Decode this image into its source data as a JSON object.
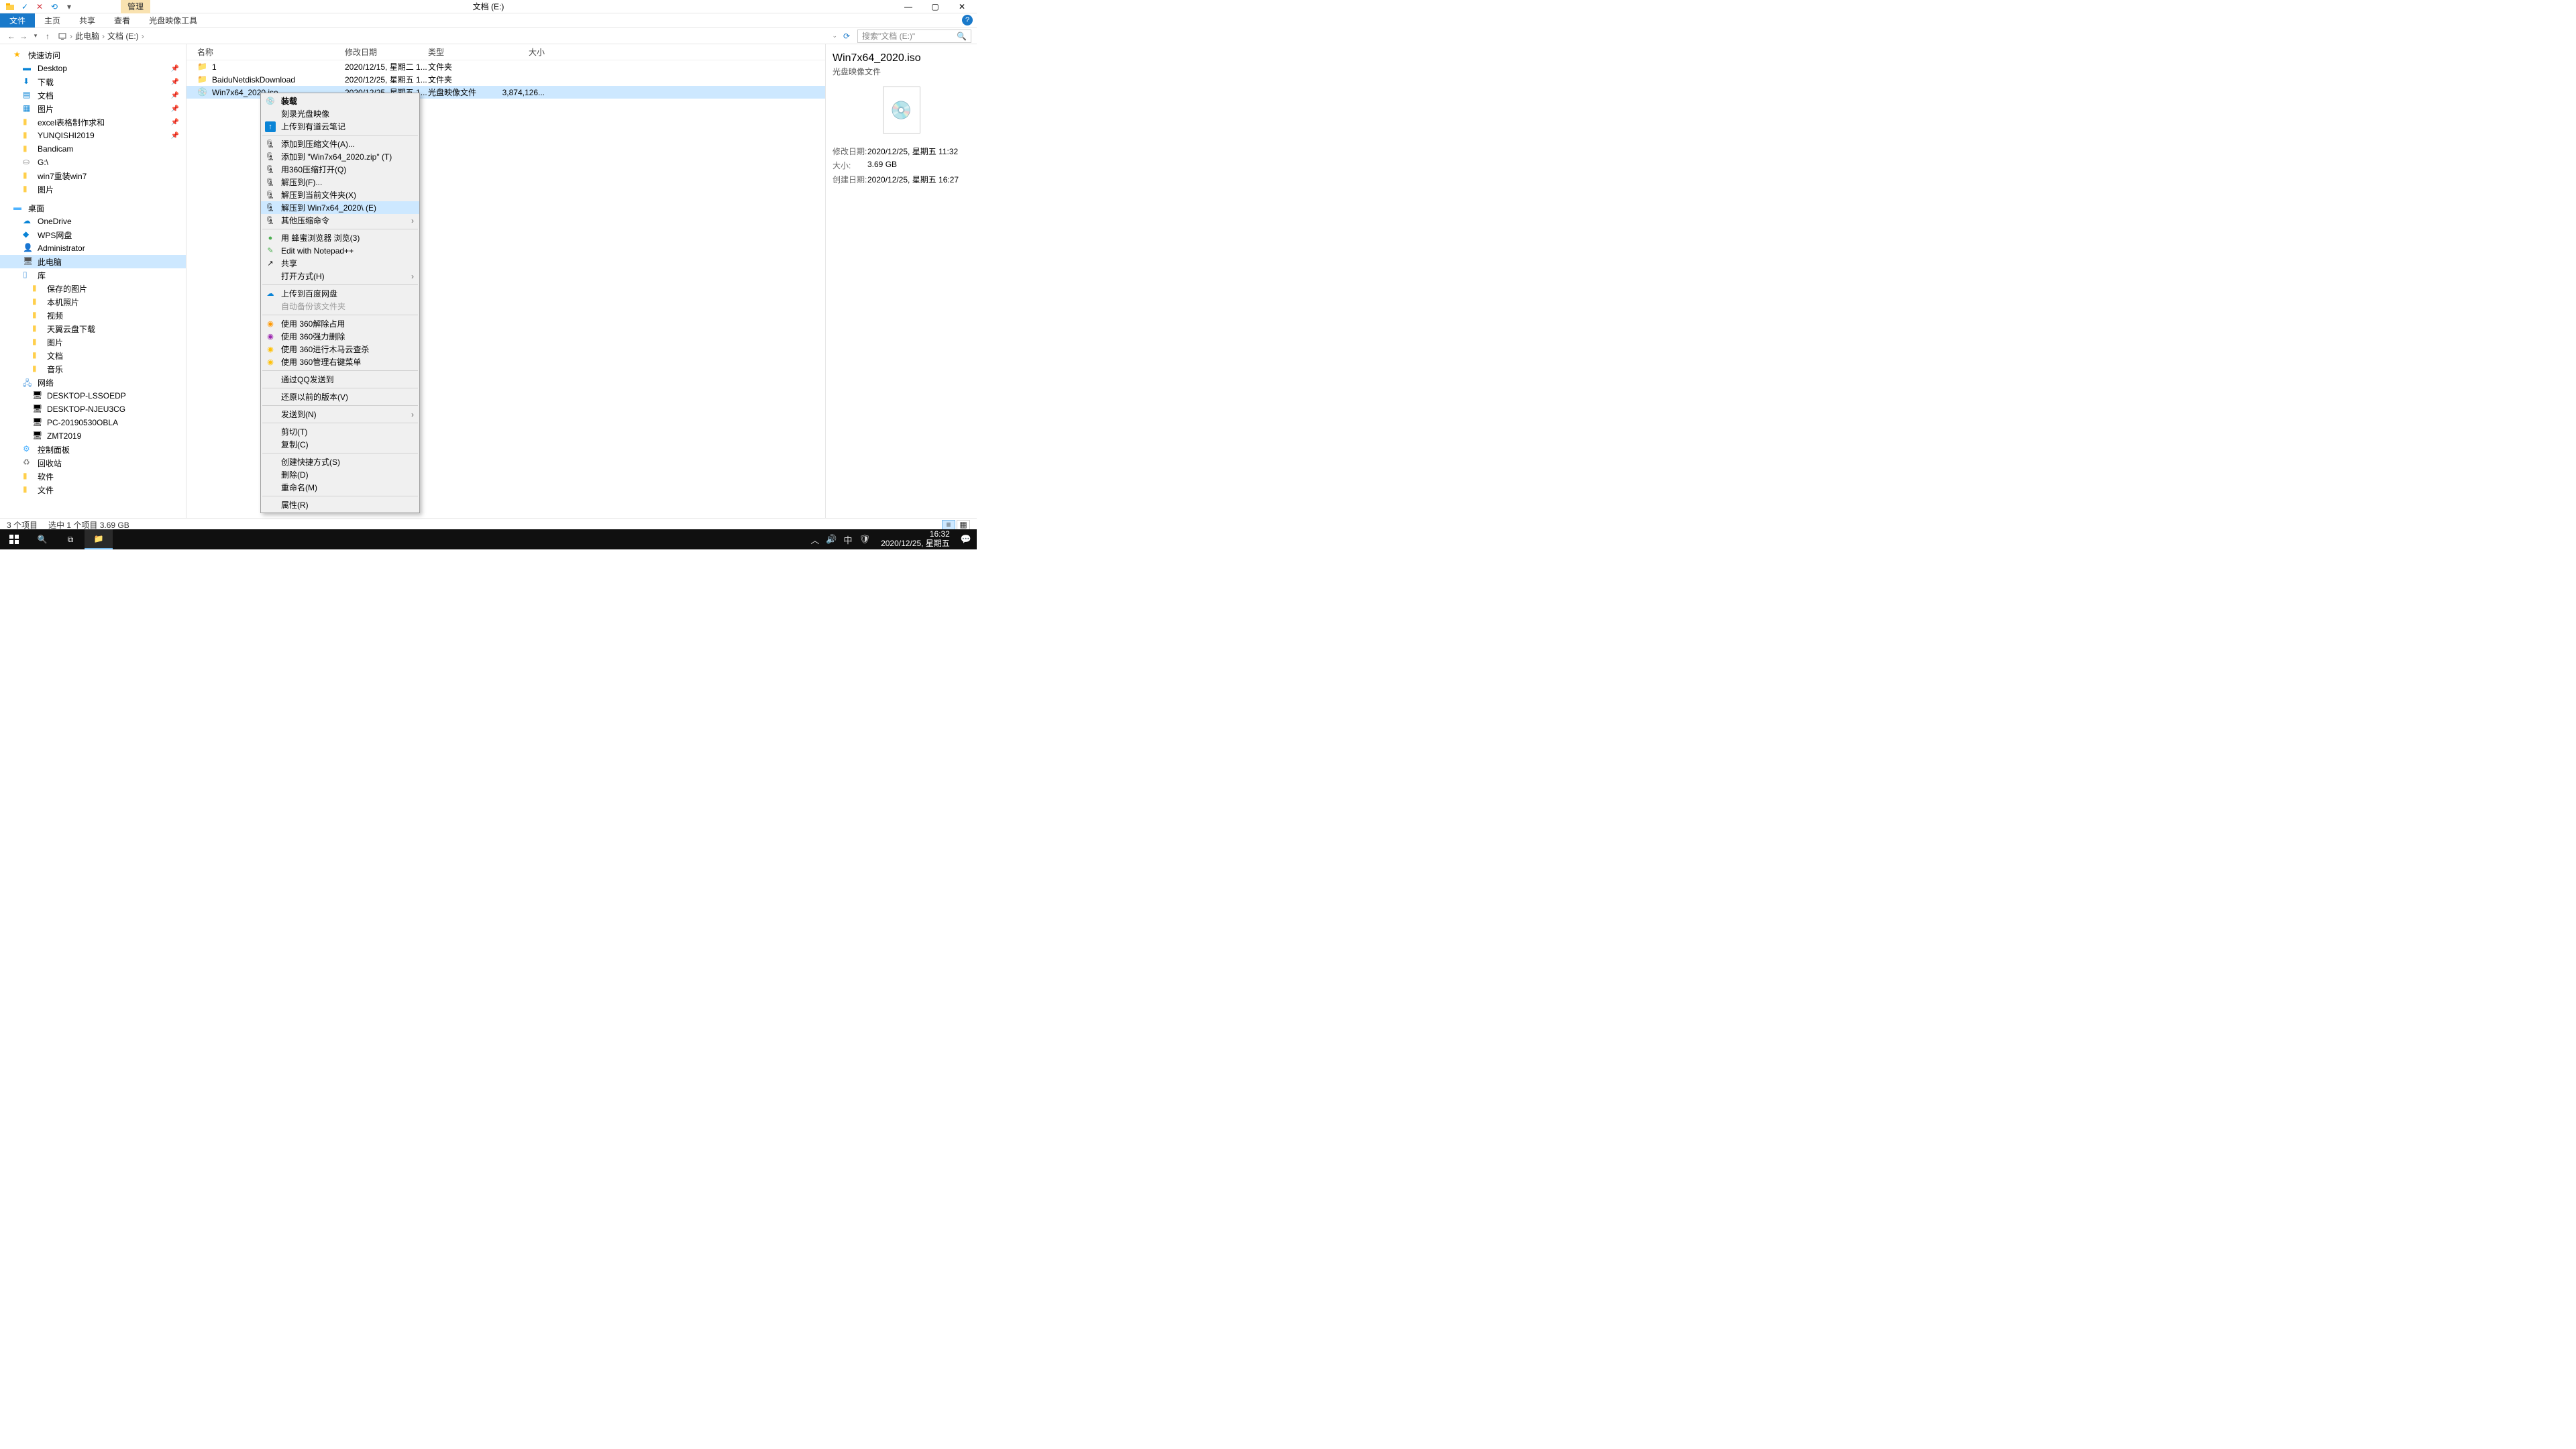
{
  "qat": {
    "manage_tab": "管理",
    "title": "文档 (E:)"
  },
  "wincontrols": {
    "min": "—",
    "max": "▢",
    "close": "✕"
  },
  "ribbon": {
    "file": "文件",
    "home": "主页",
    "share": "共享",
    "view": "查看",
    "tool": "光盘映像工具"
  },
  "breadcrumb": {
    "pc": "此电脑",
    "loc": "文档 (E:)"
  },
  "search": {
    "placeholder": "搜索\"文档 (E:)\""
  },
  "nav": {
    "quick": "快速访问",
    "quick_items": [
      "Desktop",
      "下载",
      "文档",
      "图片",
      "excel表格制作求和",
      "YUNQISHI2019",
      "Bandicam",
      "G:\\",
      "win7重装win7",
      "图片"
    ],
    "desktop": "桌面",
    "desktop_items": [
      "OneDrive",
      "WPS网盘",
      "Administrator",
      "此电脑",
      "库",
      "保存的图片",
      "本机照片",
      "视频",
      "天翼云盘下载",
      "图片",
      "文档",
      "音乐",
      "网络",
      "DESKTOP-LSSOEDP",
      "DESKTOP-NJEU3CG",
      "PC-20190530OBLA",
      "ZMT2019",
      "控制面板",
      "回收站",
      "软件",
      "文件"
    ]
  },
  "columns": {
    "name": "名称",
    "date": "修改日期",
    "type": "类型",
    "size": "大小"
  },
  "rows": [
    {
      "name": "1",
      "date": "2020/12/15, 星期二 1...",
      "type": "文件夹",
      "size": ""
    },
    {
      "name": "BaiduNetdiskDownload",
      "date": "2020/12/25, 星期五 1...",
      "type": "文件夹",
      "size": ""
    },
    {
      "name": "Win7x64_2020.iso",
      "date": "2020/12/25, 星期五 1...",
      "type": "光盘映像文件",
      "size": "3,874,126..."
    }
  ],
  "details": {
    "title": "Win7x64_2020.iso",
    "subtitle": "光盘映像文件",
    "k_mod": "修改日期:",
    "v_mod": "2020/12/25, 星期五 11:32",
    "k_size": "大小:",
    "v_size": "3.69 GB",
    "k_created": "创建日期:",
    "v_created": "2020/12/25, 星期五 16:27"
  },
  "status": {
    "count": "3 个项目",
    "sel": "选中 1 个项目  3.69 GB"
  },
  "ctx": {
    "mount": "装载",
    "burn": "刻录光盘映像",
    "youdao": "上传到有道云笔记",
    "addarchive": "添加到压缩文件(A)...",
    "addzip": "添加到 \"Win7x64_2020.zip\" (T)",
    "open360": "用360压缩打开(Q)",
    "extractto": "解压到(F)...",
    "extracthere": "解压到当前文件夹(X)",
    "extractfolder": "解压到 Win7x64_2020\\ (E)",
    "othercompress": "其他压缩命令",
    "honeybrowser": "用 蜂蜜浏览器 浏览(3)",
    "notepad": "Edit with Notepad++",
    "share": "共享",
    "openwith": "打开方式(H)",
    "baidu": "上传到百度网盘",
    "autobackup": "自动备份该文件夹",
    "u360unlock": "使用 360解除占用",
    "u360delete": "使用 360强力删除",
    "u360scan": "使用 360进行木马云查杀",
    "u360menu": "使用 360管理右键菜单",
    "qqsend": "通过QQ发送到",
    "restorever": "还原以前的版本(V)",
    "sendto": "发送到(N)",
    "cut": "剪切(T)",
    "copy": "复制(C)",
    "shortcut": "创建快捷方式(S)",
    "delete": "删除(D)",
    "rename": "重命名(M)",
    "properties": "属性(R)"
  },
  "taskbar": {
    "time": "16:32",
    "date": "2020/12/25, 星期五",
    "ime": "中"
  }
}
